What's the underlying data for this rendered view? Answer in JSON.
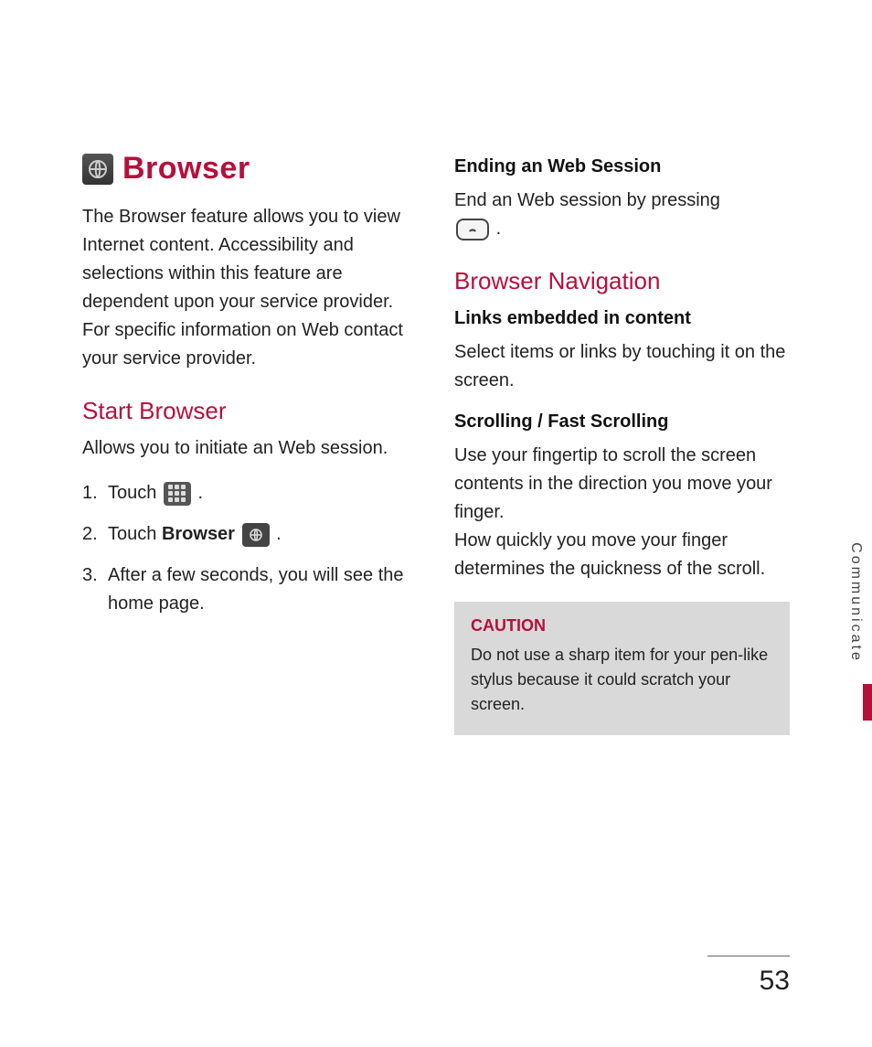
{
  "header": {
    "title": "Browser",
    "intro": "The Browser feature allows you to view Internet content. Accessibility and selections within this feature are dependent upon your service provider. For specific information on Web contact your service provider."
  },
  "left": {
    "section_title": "Start Browser",
    "section_intro": "Allows you to initiate an Web session.",
    "steps": {
      "s1_num": "1.",
      "s1_a": "Touch ",
      "s1_b": ".",
      "s2_num": "2.",
      "s2_a": "Touch ",
      "s2_b": "Browser",
      "s2_c": " ",
      "s2_d": ".",
      "s3_num": "3.",
      "s3_txt": "After a few seconds, you will see the home page."
    }
  },
  "right": {
    "h_end": "Ending an Web Session",
    "end_a": "End an Web session by pressing ",
    "end_b": ".",
    "nav_title": "Browser Navigation",
    "h_links": "Links embedded in content",
    "links_body": "Select items or links by touching it on the screen.",
    "h_scroll": "Scrolling / Fast Scrolling",
    "scroll_body": "Use your fingertip to scroll the screen contents in the direction you move your finger.\nHow quickly you move your finger determines the quickness of the scroll."
  },
  "caution": {
    "label": "CAUTION",
    "msg": "Do not use a sharp item for your pen-like stylus because it could scratch your screen."
  },
  "side_label": "Communicate",
  "page_number": "53"
}
